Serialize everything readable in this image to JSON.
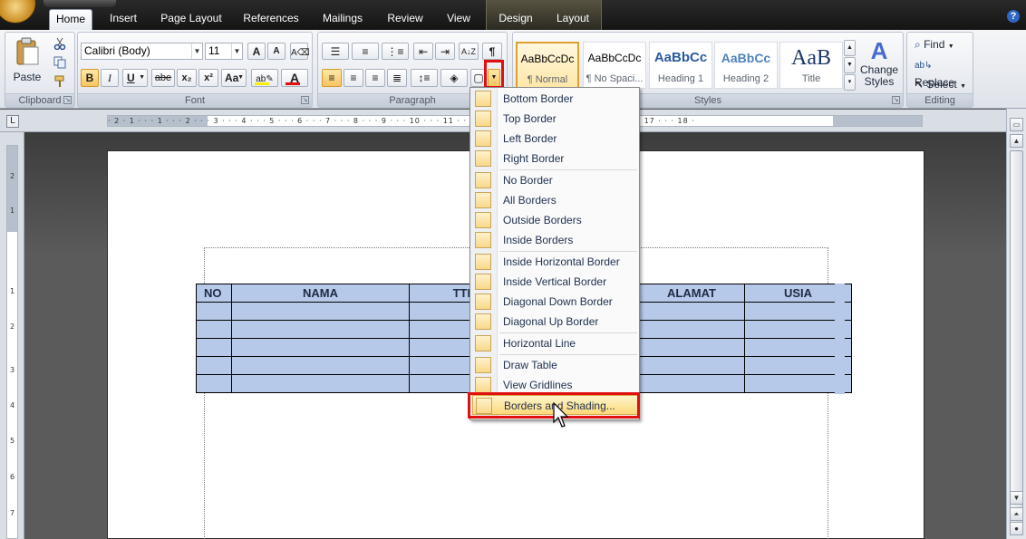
{
  "tabs": [
    "Home",
    "Insert",
    "Page Layout",
    "References",
    "Mailings",
    "Review",
    "View"
  ],
  "context_tabs": [
    "Design",
    "Layout"
  ],
  "help_label": "?",
  "clipboard": {
    "label": "Clipboard",
    "paste_label": "Paste"
  },
  "font": {
    "label": "Font",
    "font_name": "Calibri (Body)",
    "font_size": "11",
    "bold": "B",
    "italic": "I",
    "underline": "U",
    "strike": "abe",
    "subscript": "x₂",
    "superscript": "x²",
    "change_case": "Aa",
    "grow": "A",
    "shrink": "A"
  },
  "paragraph": {
    "label": "Paragraph",
    "pilcrow": "¶",
    "sort": "A↓Z"
  },
  "styles": {
    "label": "Styles",
    "items": [
      {
        "sample": "AaBbCcDc",
        "name": "¶ Normal"
      },
      {
        "sample": "AaBbCcDc",
        "name": "¶ No Spaci..."
      },
      {
        "sample": "AaBbCc",
        "name": "Heading 1"
      },
      {
        "sample": "AaBbCc",
        "name": "Heading 2"
      },
      {
        "sample": "AaB",
        "name": "Title"
      }
    ],
    "change_styles_line1": "Change",
    "change_styles_line2": "Styles"
  },
  "editing": {
    "label": "Editing",
    "find": "Find",
    "replace": "Replace",
    "select": "Select"
  },
  "ruler": {
    "text": "· 2 · 1 · · · 1 · · · 2 · · · 3 · · · 4 · · · 5 · · · 6 · · · 7 · · · 8 · · · 9 · · · 10 · · · 11 · · · 12 · · · 13 · · · 14 · · · 15 · · · 16 · · · 17 · · · 18 ·",
    "corner": "L"
  },
  "vruler_ticks": [
    "2",
    "1",
    "1",
    "2",
    "3",
    "4",
    "5",
    "6",
    "7"
  ],
  "table": {
    "headers": [
      "NO",
      "NAMA",
      "TTL",
      "",
      "ALAMAT",
      "USIA"
    ],
    "empty_rows": 5
  },
  "menu": {
    "items": [
      {
        "label": "Bottom Border",
        "icon": "bottom-border-icon",
        "group": 0
      },
      {
        "label": "Top Border",
        "icon": "top-border-icon",
        "group": 0
      },
      {
        "label": "Left Border",
        "icon": "left-border-icon",
        "group": 0
      },
      {
        "label": "Right Border",
        "icon": "right-border-icon",
        "group": 0
      },
      {
        "label": "No Border",
        "icon": "no-border-icon",
        "group": 1
      },
      {
        "label": "All Borders",
        "icon": "all-borders-icon",
        "group": 1
      },
      {
        "label": "Outside Borders",
        "icon": "outside-borders-icon",
        "group": 1
      },
      {
        "label": "Inside Borders",
        "icon": "inside-borders-icon",
        "group": 1
      },
      {
        "label": "Inside Horizontal Border",
        "icon": "inside-horizontal-border-icon",
        "group": 2
      },
      {
        "label": "Inside Vertical Border",
        "icon": "inside-vertical-border-icon",
        "group": 2
      },
      {
        "label": "Diagonal Down Border",
        "icon": "diagonal-down-border-icon",
        "group": 2
      },
      {
        "label": "Diagonal Up Border",
        "icon": "diagonal-up-border-icon",
        "group": 2
      },
      {
        "label": "Horizontal Line",
        "icon": "horizontal-line-icon",
        "group": 3
      },
      {
        "label": "Draw Table",
        "icon": "draw-table-icon",
        "group": 4
      },
      {
        "label": "View Gridlines",
        "icon": "view-gridlines-icon",
        "group": 4
      },
      {
        "label": "Borders and Shading...",
        "icon": "borders-and-shading-icon",
        "group": 4
      }
    ]
  },
  "colors": {
    "table_fill": "#b7c9e8",
    "highlight_box": "#e01010",
    "font_color_bar": "#e01010",
    "highlight_color_bar": "#f8f000"
  }
}
